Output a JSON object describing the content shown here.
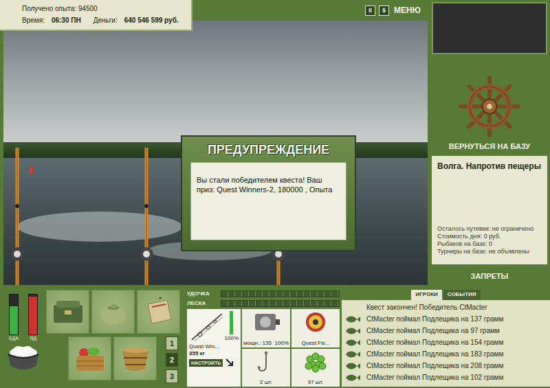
{
  "status": {
    "experience_label": "Получено опыта:",
    "experience": "94500",
    "time_label": "Время:",
    "time": "06:30 ПН",
    "money_label": "Деньги:",
    "money": "640 546 599 руб."
  },
  "top_buttons": [
    {
      "label": "II",
      "kind": "square"
    },
    {
      "label": "$",
      "kind": "square"
    },
    {
      "label": "МЕНЮ",
      "kind": "text"
    }
  ],
  "dialog": {
    "title": "ПРЕДУПРЕЖДЕНИЕ",
    "message": "Вы стали победителем квеста! Ваш приз: Quest Winners-2, 180000 , Опыта"
  },
  "base": {
    "return_label": "ВЕРНУТЬСЯ НА БАЗУ",
    "location": "Волга. Напротив пещеры",
    "info": [
      "Осталось путевки: не ограничено",
      "Стоимость дня: 0 руб.",
      "Рыбаков на базе: 0",
      "Турниры на базе: не объявлены"
    ],
    "bans_label": "ЗАПРЕТЫ"
  },
  "meters": [
    {
      "label": "ЕДА",
      "level": 0.7,
      "color": "#3cb043"
    },
    {
      "label": "ЯД",
      "level": 0.95,
      "color": "#d03030"
    }
  ],
  "slots": [
    {
      "label": "1",
      "selected": false
    },
    {
      "label": "2",
      "selected": true
    },
    {
      "label": "3",
      "selected": false
    }
  ],
  "tackle": {
    "bars": [
      {
        "label": "УДОЧКА",
        "level": 0
      },
      {
        "label": "ЛЕСКА",
        "level": 0
      }
    ],
    "rod": {
      "name": "Quest Win...",
      "capacity": "355 кг",
      "condition": "100%",
      "level": 1,
      "button": "НАСТРОИТЬ"
    },
    "reel": {
      "power": "мощн.: 135",
      "condition": "100%"
    },
    "line": {
      "name": "Quest Fis..."
    },
    "hook": {
      "count": "2 шт."
    },
    "bait": {
      "count": "97 шт."
    }
  },
  "players": {
    "tabs": [
      {
        "label": "ИГРОКИ",
        "selected": true
      },
      {
        "label": "СОБЫТИЯ",
        "selected": false
      }
    ],
    "messages": [
      {
        "text": "Квест закончен! Победитель CtMacter",
        "kind": "notice"
      },
      {
        "text": "CtMacter поймал Подлещика на 137 грамм",
        "kind": "catch"
      },
      {
        "text": "CtMacter поймал Подлещика на 97 грамм",
        "kind": "catch"
      },
      {
        "text": "CtMacter поймал Подлещика на 154 грамм",
        "kind": "catch"
      },
      {
        "text": "CtMacter поймал Подлещика на 183 грамм",
        "kind": "catch"
      },
      {
        "text": "CtMacter поймал Подлещика на 208 грамм",
        "kind": "catch"
      },
      {
        "text": "CtMacter поймал Подлещика на 102 грамм",
        "kind": "catch"
      }
    ]
  }
}
